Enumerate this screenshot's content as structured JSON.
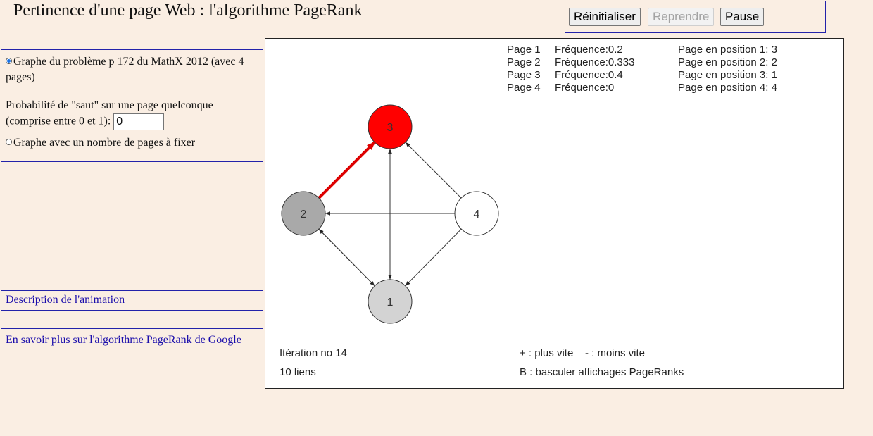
{
  "page_title": "Pertinence d'une page Web : l'algorithme PageRank",
  "controls": {
    "reset_label": "Réinitialiser",
    "resume_label": "Reprendre",
    "pause_label": "Pause"
  },
  "options": {
    "option1_label": "Graphe du problème p 172 du MathX 2012 (avec 4 pages)",
    "option1_selected": true,
    "jump_label_line1": "Probabilité de \"saut\" sur une page quelconque",
    "jump_label_line2": "(comprise entre 0 et 1):",
    "jump_value": "0",
    "option2_label": "Graphe avec un nombre de pages à fixer",
    "option2_selected": false
  },
  "links": {
    "description": "Description de l'animation",
    "learn_more": "En savoir plus sur l'algorithme PageRank de Google"
  },
  "graph": {
    "nodes": [
      {
        "id": "1",
        "label": "1",
        "color": "#d3d3d3"
      },
      {
        "id": "2",
        "label": "2",
        "color": "#a9a9a9"
      },
      {
        "id": "3",
        "label": "3",
        "color": "#ff0000"
      },
      {
        "id": "4",
        "label": "4",
        "color": "#ffffff"
      }
    ],
    "edges": [
      {
        "from": "2",
        "to": "3",
        "highlight": true
      },
      {
        "from": "1",
        "to": "3"
      },
      {
        "from": "3",
        "to": "1"
      },
      {
        "from": "4",
        "to": "3"
      },
      {
        "from": "4",
        "to": "2"
      },
      {
        "from": "4",
        "to": "1"
      },
      {
        "from": "2",
        "to": "1"
      },
      {
        "from": "1",
        "to": "2"
      }
    ],
    "highlight_color": "#dd0000"
  },
  "stats": {
    "frequencies": [
      {
        "page": "Page 1",
        "freq": "Fréquence:0.2",
        "position": "Page en position 1: 3"
      },
      {
        "page": "Page 2",
        "freq": "Fréquence:0.333",
        "position": "Page en position 2: 2"
      },
      {
        "page": "Page 3",
        "freq": "Fréquence:0.4",
        "position": "Page en position 3: 1"
      },
      {
        "page": "Page 4",
        "freq": "Fréquence:0",
        "position": "Page en position 4: 4"
      }
    ],
    "iteration": "Itération no 14",
    "link_count": "10 liens",
    "speed_help": "+ : plus vite    - : moins vite",
    "toggle_help": "B : basculer affichages PageRanks"
  }
}
